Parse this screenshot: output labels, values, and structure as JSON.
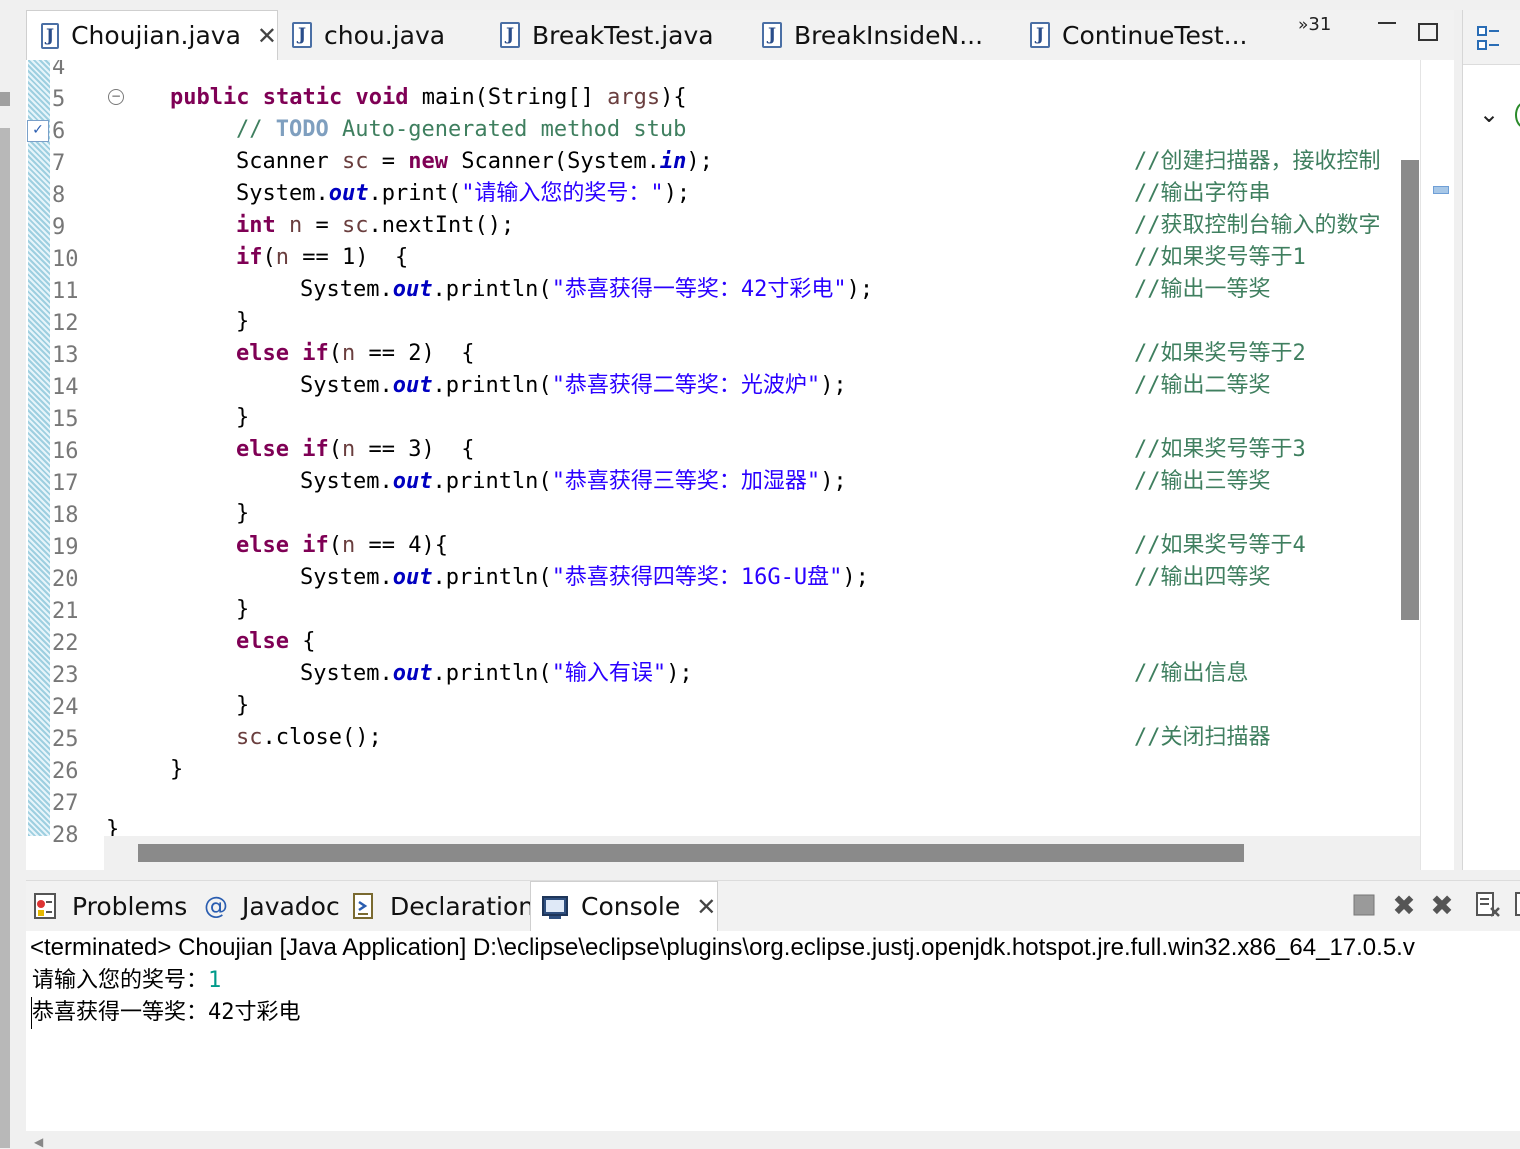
{
  "editor_tabs": [
    {
      "label": "Choujian.java",
      "active": true,
      "closable": true
    },
    {
      "label": "chou.java",
      "active": false
    },
    {
      "label": "BreakTest.java",
      "active": false
    },
    {
      "label": "BreakInsideN...",
      "active": false
    },
    {
      "label": "ContinueTest...",
      "active": false
    }
  ],
  "overflow": {
    "chevron": "»",
    "count": "31"
  },
  "line_numbers": [
    "4",
    "5",
    "6",
    "7",
    "8",
    "9",
    "10",
    "11",
    "12",
    "13",
    "14",
    "15",
    "16",
    "17",
    "18",
    "19",
    "20",
    "21",
    "22",
    "23",
    "24",
    "25",
    "26",
    "27",
    "28"
  ],
  "code": {
    "public": "public",
    "static": "static",
    "void": "void",
    "main_sig": "main(String[] ",
    "args": "args",
    "main_end": "){",
    "todo_prefix": "// ",
    "todo": "TODO",
    "todo_rest": " Auto-generated method stub",
    "scanner": "Scanner ",
    "sc": "sc",
    "eq": " = ",
    "new": "new",
    "scanner_ctor": " Scanner(System.",
    "in": "in",
    "close_paren_semi": ");",
    "system_dot": "System.",
    "out": "out",
    "print_open": ".print(",
    "println_open": ".println(",
    "prompt_str": "\"请输入您的奖号：\"",
    "int": "int",
    "n": "n",
    "nextint": ".nextInt();",
    "if": "if",
    "else": "else",
    "open_paren": "(",
    "eq1": " == 1)  {",
    "eq2": " == 2)  {",
    "eq3": " == 3)  {",
    "eq4": " == 4){",
    "close_brace": "}",
    "else_brace": " {",
    "str1": "\"恭喜获得一等奖：42寸彩电\"",
    "str2": "\"恭喜获得二等奖：光波炉\"",
    "str3": "\"恭喜获得三等奖：加湿器\"",
    "str4": "\"恭喜获得四等奖：16G-U盘\"",
    "str5": "\"输入有误\"",
    "close_call": ".close();",
    "cut_brace": "}"
  },
  "comments": {
    "c7": "//创建扫描器，接收控制",
    "c8": "//输出字符串",
    "c9": "//获取控制台输入的数字",
    "c10": "//如果奖号等于1",
    "c11": "//输出一等奖",
    "c13": "//如果奖号等于2",
    "c14": "//输出二等奖",
    "c16": "//如果奖号等于3",
    "c17": "//输出三等奖",
    "c19": "//如果奖号等于4",
    "c20": "//输出四等奖",
    "c23": "//输出信息",
    "c25": "//关闭扫描器"
  },
  "bottom_tabs": [
    {
      "label": "Problems",
      "icon": "problems-icon"
    },
    {
      "label": "Javadoc",
      "icon": "at-icon"
    },
    {
      "label": "Declaration",
      "icon": "declaration-icon"
    },
    {
      "label": "Console",
      "icon": "console-icon",
      "active": true,
      "closable": true
    }
  ],
  "console": {
    "header": "<terminated> Choujian [Java Application] D:\\eclipse\\eclipse\\plugins\\org.eclipse.justj.openjdk.hotspot.jre.full.win32.x86_64_17.0.5.v",
    "prompt": "请输入您的奖号：",
    "input": "1",
    "result": "恭喜获得一等奖：42寸彩电"
  },
  "colors": {
    "keyword": "#7f0055",
    "string": "#2a00ff",
    "field": "#0000c0",
    "comment": "#3f7f5f",
    "local_var": "#6a3e3e",
    "console_input": "#009a8a"
  }
}
